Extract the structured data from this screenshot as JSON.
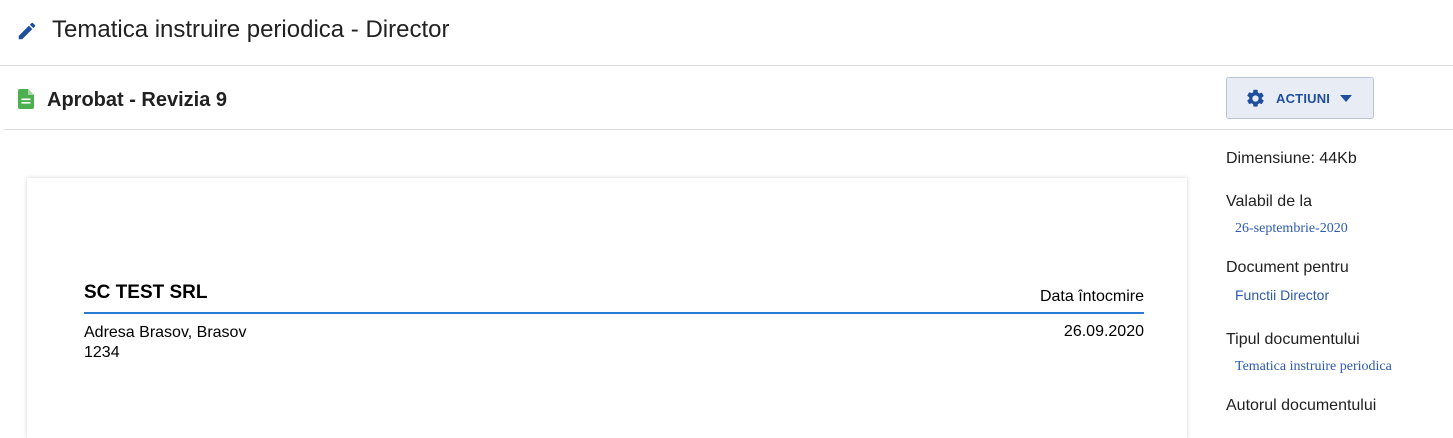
{
  "header": {
    "title": "Tematica instruire periodica - Director",
    "icon": "pencil-icon",
    "icon_color": "#1f4e9c"
  },
  "status": {
    "label": "Aprobat - Revizia 9",
    "icon": "document-icon",
    "icon_color": "#4caf50"
  },
  "actions": {
    "label": "ACTIUNI",
    "icon": "gear-icon",
    "accent": "#1f4e9c"
  },
  "document": {
    "company": "SC TEST SRL",
    "date_label": "Data întocmire",
    "address_line1": "Adresa Brasov, Brasov",
    "address_line2": "1234",
    "date_value": "26.09.2020",
    "rule_color": "#2a7bd2"
  },
  "sidebar": {
    "size": "Dimensiune: 44Kb",
    "valid_from_label": "Valabil de la",
    "valid_from_value": "26-septembrie-2020",
    "for_label": "Document pentru",
    "for_value": "Functii Director",
    "type_label": "Tipul documentului",
    "type_value": "Tematica instruire periodica",
    "author_label": "Autorul documentului"
  }
}
